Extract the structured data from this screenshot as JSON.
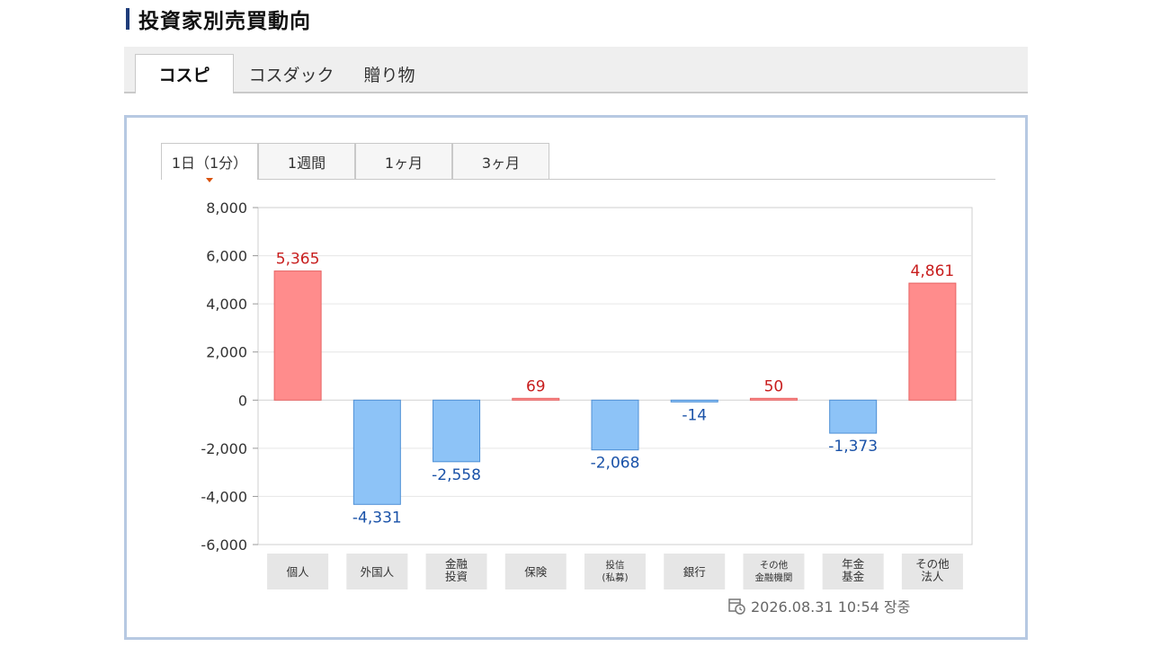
{
  "page": {
    "title": "投資家別売買動向"
  },
  "market_tabs": [
    {
      "label": "コスピ",
      "active": true
    },
    {
      "label": "コスダック",
      "active": false
    },
    {
      "label": "贈り物",
      "active": false
    }
  ],
  "period_tabs": [
    {
      "label": "1日（1分）",
      "active": true
    },
    {
      "label": "1週間",
      "active": false
    },
    {
      "label": "1ヶ月",
      "active": false
    },
    {
      "label": "3ヶ月",
      "active": false
    }
  ],
  "timestamp": "2026.08.31 10:54 장중",
  "icons": {
    "timestamp": "calendar-clock-icon"
  },
  "colors": {
    "positive_fill": "#ff8c8c",
    "positive_stroke": "#e76464",
    "positive_label": "#c81e1e",
    "negative_fill": "#8dc3f7",
    "negative_stroke": "#4d8fd6",
    "negative_label": "#1a52a8"
  },
  "chart_data": {
    "type": "bar",
    "categories": [
      [
        "個人"
      ],
      [
        "外国人"
      ],
      [
        "金融",
        "投資"
      ],
      [
        "保険"
      ],
      [
        "投信",
        "(私募)"
      ],
      [
        "銀行"
      ],
      [
        "その他",
        "金融機関"
      ],
      [
        "年金",
        "基金"
      ],
      [
        "その他",
        "法人"
      ]
    ],
    "values": [
      5365,
      -4331,
      -2558,
      69,
      -2068,
      -14,
      50,
      -1373,
      4861
    ],
    "data_labels": [
      "5,365",
      "-4,331",
      "-2,558",
      "69",
      "-2,068",
      "-14",
      "50",
      "-1,373",
      "4,861"
    ],
    "yticks": [
      8000,
      6000,
      4000,
      2000,
      0,
      -2000,
      -4000,
      -6000
    ],
    "ytick_labels": [
      "8,000",
      "6,000",
      "4,000",
      "2,000",
      "0",
      "-2,000",
      "-4,000",
      "-6,000"
    ],
    "ylim": [
      -6000,
      8000
    ],
    "grid": true,
    "title": "",
    "xlabel": "",
    "ylabel": ""
  }
}
